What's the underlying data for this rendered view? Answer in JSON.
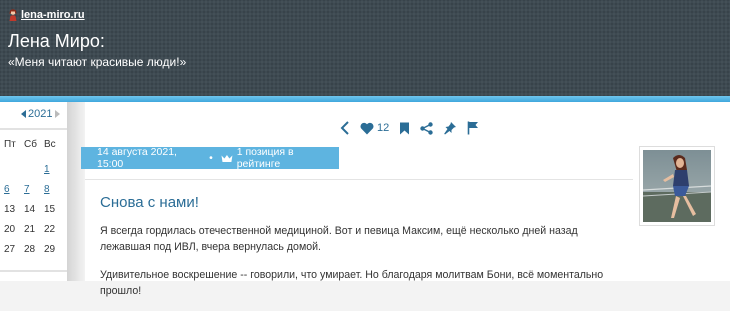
{
  "header": {
    "site_name": "lena-miro.ru",
    "blog_title": "Лена Миро:",
    "subtitle": "«Меня читают красивые люди!»"
  },
  "calendar": {
    "year": "2021",
    "weekdays": [
      "Пт",
      "Сб",
      "Вс"
    ],
    "days": [
      [
        "",
        "",
        "1"
      ],
      [
        "6",
        "7",
        "8"
      ],
      [
        "13",
        "14",
        "15"
      ],
      [
        "20",
        "21",
        "22"
      ],
      [
        "27",
        "28",
        "29"
      ]
    ],
    "linked_days": [
      "1",
      "6",
      "7",
      "8"
    ]
  },
  "toolbar": {
    "icons": [
      "back-icon",
      "heart-icon",
      "bookmark-icon",
      "share-icon",
      "pin-icon",
      "flag-icon"
    ],
    "likes_count": "12"
  },
  "post": {
    "date": "14 августа 2021, 15:00",
    "separator": "•",
    "rating": "1 позиция в рейтинге",
    "title": "Снова с нами!",
    "paragraphs": [
      "Я всегда гордилась отечественной медициной. Вот и певица Максим, ещё несколько дней назад лежавшая под ИВЛ, вчера вернулась домой.",
      "Удивительное воскрешение -- говорили, что умирает. Но благодаря молитвам Бони, всё моментально прошло!"
    ]
  },
  "colors": {
    "header_bg": "#3e4a52",
    "accent": "#5eb4e0",
    "link": "#2b6d96"
  }
}
